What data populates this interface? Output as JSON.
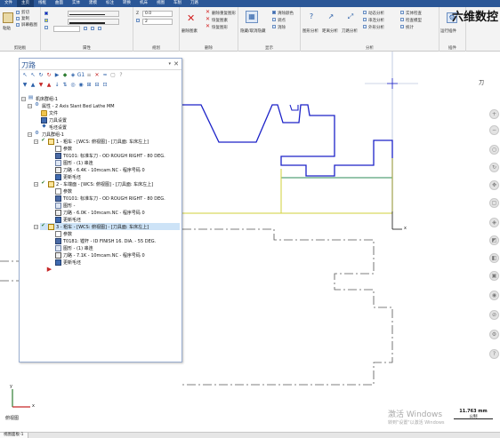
{
  "menubar": {
    "items": [
      "文件",
      "主页",
      "线框",
      "曲面",
      "实体",
      "建模",
      "标注",
      "转换",
      "机床",
      "视图",
      "车削",
      "刀路"
    ]
  },
  "ribbon": {
    "clipboard": {
      "label": "剪贴板",
      "paste": "粘贴",
      "cut": "剪切",
      "copy": "复制",
      "copy_image": "屏幕截图"
    },
    "attributes": {
      "label": "属性"
    },
    "plane": {
      "label": "规划",
      "z_value": "0.0",
      "layer": "2"
    },
    "delete": {
      "label": "删除",
      "delete_entities": "删除图素",
      "undelete": "恢复图素",
      "delete_duplicates": "删除重复图形",
      "restore_entities": "恢复图形",
      "restore_count": "恢复图形"
    },
    "display": {
      "label": "显示",
      "show_hide": "隐藏/取消隐藏",
      "xyz_label": "清除颜色",
      "center": "调点",
      "surface": "消除"
    },
    "analyze": {
      "label": "分析",
      "entity_analysis": "图形分析",
      "distance_analysis": "距离分析",
      "angle_analysis": "刀路分析",
      "dynamic_analysis": "动态分析",
      "chain_analysis": "串连分析",
      "contour_analysis": "外形分析",
      "body_check": "实体检查",
      "check_model": "检查模型",
      "stats": "统计"
    },
    "addins": {
      "label": "插件",
      "run_addin": "运行插件"
    },
    "brand": "六维数控"
  },
  "panel": {
    "title": "刀路",
    "tree": {
      "machine_group": "机床群组-1",
      "properties": "属性 - 2 Axis Slant Bed Lathe MM",
      "files": "文件",
      "tool_settings": "刀具设置",
      "stock_settings": "毛坯设置",
      "toolpath_group": "刀具群组-1",
      "ops": [
        {
          "name": "1 - 粗车 - [WCS: 俯视图] - [刀具面: 车床左上]",
          "params": "参数",
          "tool": "T0101: 标准车刀 - OD ROUGH RIGHT - 80 DEG.",
          "geometry": "图形 - (1) 串连",
          "toolpath": "刀路 - 6.4K - 10mcam.NC - 程序号码 0",
          "update": "更新毛坯"
        },
        {
          "name": "2 - 车端面 - [WCS: 俯视图] - [刀具面: 车床左上]",
          "params": "参数",
          "tool": "T0101: 标准车刀 - OD ROUGH RIGHT - 80 DEG.",
          "geometry": "图形 -",
          "toolpath": "刀路 - 6.0K - 10mcam.NC - 程序号码 0",
          "update": "更新毛坯"
        },
        {
          "name": "3 - 粗车 - [WCS: 俯视图] - [刀具面: 车床左上]",
          "params": "参数",
          "tool": "T0181: 镗杆 - ID FINISH 16. DIA. - 55 DEG.",
          "geometry": "图形 - (1) 串连",
          "toolpath": "刀路 - 7.1K - 10mcam.NC - 程序号码 0",
          "update": "更新毛坯"
        }
      ]
    }
  },
  "viewport": {
    "view_name": "俯视图",
    "scale_value": "11.763 mm",
    "scale_unit": "公制",
    "watermark_title": "激活 Windows",
    "watermark_sub": "转到\"设置\"以激活 Windows",
    "axis_x": "x",
    "axis_y": "y",
    "axis_label_top": "刀"
  },
  "status": {
    "tab": "视图面板-1"
  },
  "colors": {
    "menubar": "#2b5797",
    "part_blue": "#1c22c8",
    "stock_yellow": "#d2d23a",
    "toolpath_green": "#2e8b57",
    "centerline": "#555555"
  }
}
